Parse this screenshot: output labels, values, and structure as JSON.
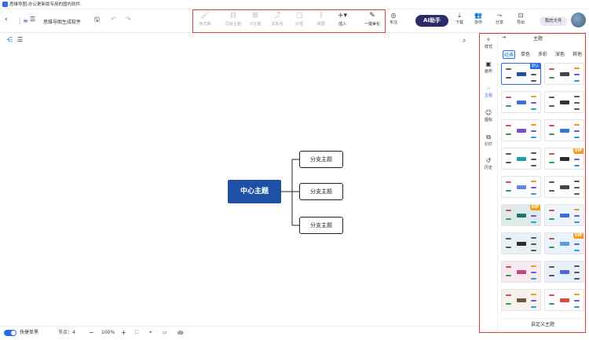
{
  "titlebar": {
    "title": "思维导图-办公更新版专用的国内软件"
  },
  "toolbar": {
    "doc_title": "思维导图生成软件",
    "tools": [
      {
        "label": "格式刷",
        "icon": "format-brush-icon"
      },
      {
        "label": "同级主题",
        "icon": "sibling-topic-icon"
      },
      {
        "label": "子主题",
        "icon": "subtopic-icon"
      },
      {
        "label": "关系线",
        "icon": "relation-line-icon"
      },
      {
        "label": "外框",
        "icon": "boundary-icon"
      },
      {
        "label": "概要",
        "icon": "summary-icon"
      },
      {
        "label": "插入",
        "icon": "plus-icon"
      },
      {
        "label": "一键美化",
        "icon": "magic-wand-icon"
      }
    ],
    "focus_label": "专注",
    "ai_label": "AI助手",
    "download_label": "下载",
    "collab_label": "协作",
    "share_label": "分享",
    "export_label": "导出",
    "my_files_label": "我的文件"
  },
  "canvas": {
    "root_topic": "中心主题",
    "branches": [
      "分支主题",
      "分支主题",
      "分支主题"
    ]
  },
  "sidenav": {
    "items": [
      {
        "label": "样式",
        "icon": "style-icon"
      },
      {
        "label": "画布",
        "icon": "canvas-icon"
      },
      {
        "label": "主题",
        "icon": "theme-icon"
      },
      {
        "label": "图标",
        "icon": "emoji-icon"
      },
      {
        "label": "幻灯",
        "icon": "slides-icon"
      },
      {
        "label": "历史",
        "icon": "history-icon"
      }
    ],
    "active": "主题"
  },
  "panel": {
    "title": "主题",
    "tabs": [
      "经典",
      "单色",
      "多彩",
      "深色",
      "其他"
    ],
    "active_tab": "经典",
    "default_badge": "默认",
    "vip_badge": "VIP",
    "custom_button": "自定义主题"
  },
  "statusbar": {
    "quick_label": "快捷单黑",
    "node_count": "节点：4",
    "zoom": "100%"
  },
  "colors": {
    "accent": "#2b6de0",
    "root": "#1e50a6",
    "highlight": "#e03c3c",
    "vip": "#f0a020"
  }
}
